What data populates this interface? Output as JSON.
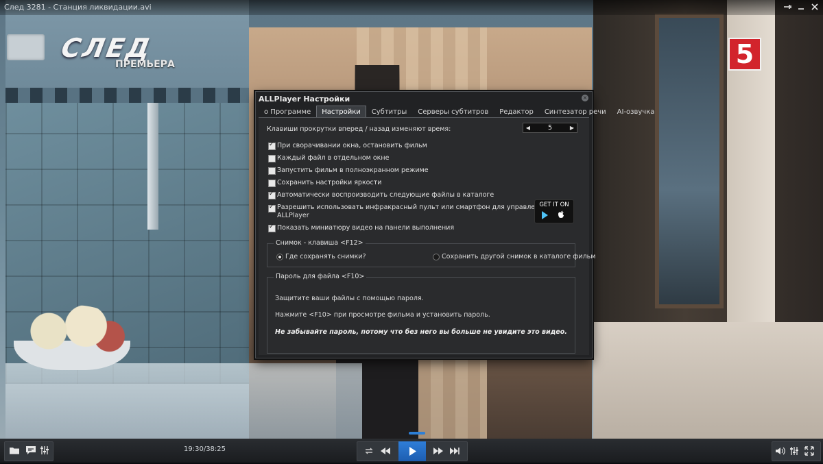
{
  "window": {
    "title": "След 3281 - Станция ликвидации.avi"
  },
  "video": {
    "logo_text": "СЛЕД",
    "logo_subtitle": "ПРЕМЬЕРА",
    "channel_logo": "5"
  },
  "dialog": {
    "title": "ALLPlayer Настройки",
    "tabs": [
      {
        "label": "о Программе",
        "active": false
      },
      {
        "label": "Настройки",
        "active": true
      },
      {
        "label": "Субтитры",
        "active": false
      },
      {
        "label": "Серверы субтитров",
        "active": false
      },
      {
        "label": "Редактор",
        "active": false
      },
      {
        "label": "Синтезатор речи",
        "active": false
      },
      {
        "label": "AI-озвучка",
        "active": false
      }
    ],
    "scroll_label": "Клавиши прокрутки вперед / назад изменяют время:",
    "scroll_value": "5",
    "options": [
      {
        "label": "При сворачивании окна, остановить фильм",
        "checked": true
      },
      {
        "label": "Каждый файл в отдельном окне",
        "checked": false
      },
      {
        "label": "Запустить фильм в полноэкранном режиме",
        "checked": false
      },
      {
        "label": "Сохранить настройки яркости",
        "checked": false
      },
      {
        "label": "Автоматически воспроизводить следующие файлы в каталоге",
        "checked": true
      },
      {
        "label": "Разрешить использовать инфракрасный пульт или смартфон для управления",
        "label_line2": "ALLPlayer",
        "checked": true
      },
      {
        "label": "Показать миниатюру видео на панели выполнения",
        "checked": true
      }
    ],
    "store_badge": "GET IT ON",
    "snapshot": {
      "legend": "Снимок - клавиша <F12>",
      "option_where": "Где сохранять снимки?",
      "option_where_selected": true,
      "option_other": "Сохранить другой снимок в каталоге фильм",
      "option_other_selected": false
    },
    "password": {
      "legend": "Пароль для файла <F10>",
      "line1": "Защитите ваши файлы с помощью пароля.",
      "line2": "Нажмите <F10> при просмотре фильма и установить пароль.",
      "warning": "Не забывайте пароль, потому что без него вы больше не увидите это видео."
    }
  },
  "player": {
    "time": "19:30/38:25",
    "progress": 0.507,
    "accent_color": "#2d7fd6"
  },
  "icons": {
    "open": "folder-icon",
    "subtitles": "subtitles-icon",
    "equalizer": "equalizer-icon",
    "repeat": "repeat-icon",
    "rewind": "rewind-icon",
    "play": "play-icon",
    "forward": "fast-forward-icon",
    "next": "next-track-icon",
    "volume": "volume-icon",
    "settings": "equalizer-icon",
    "fullscreen": "fullscreen-icon"
  }
}
